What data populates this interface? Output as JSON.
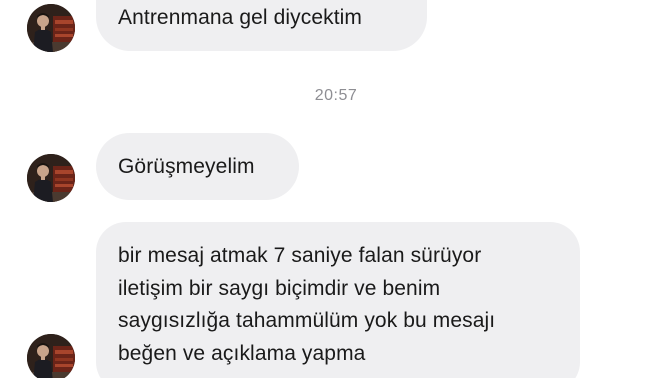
{
  "messages": [
    {
      "text": "Antrenmana gel diycektim"
    },
    {
      "text": "Görüşmeyelim"
    },
    {
      "lines": [
        "bir mesaj atmak 7 saniye falan sürüyor",
        "iletişim bir saygı biçimdir ve benim",
        "saygısızlığa tahammülüm yok bu mesajı",
        "beğen ve açıklama yapma"
      ]
    }
  ],
  "timestamp": "20:57",
  "colors": {
    "bubble_background": "#efeff1",
    "text": "#1a1a1a",
    "timestamp": "#8e8e93"
  },
  "icons": {
    "avatar": "contact-avatar-photo"
  }
}
